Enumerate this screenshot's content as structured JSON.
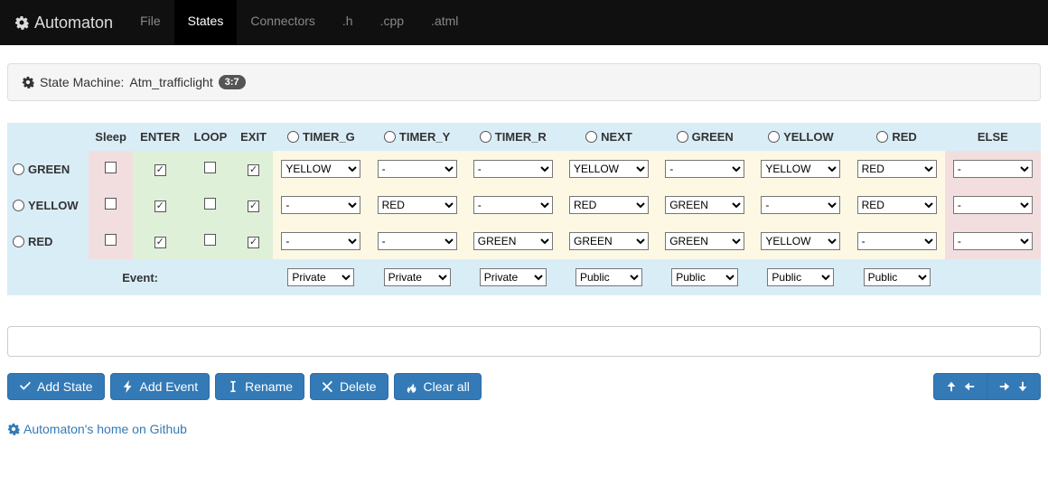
{
  "navbar": {
    "brand": "Automaton",
    "items": [
      {
        "label": "File",
        "active": false
      },
      {
        "label": "States",
        "active": true
      },
      {
        "label": "Connectors",
        "active": false
      },
      {
        "label": ".h",
        "active": false
      },
      {
        "label": ".cpp",
        "active": false
      },
      {
        "label": ".atml",
        "active": false
      }
    ]
  },
  "panel": {
    "prefix": "State Machine:",
    "name": "Atm_trafficlight",
    "badge": "3:7"
  },
  "columns": {
    "name_header": "",
    "sleep": "Sleep",
    "enter": "ENTER",
    "loop": "LOOP",
    "exit": "EXIT",
    "events": [
      "TIMER_G",
      "TIMER_Y",
      "TIMER_R",
      "NEXT",
      "GREEN",
      "YELLOW",
      "RED"
    ],
    "else": "ELSE"
  },
  "states": [
    {
      "name": "GREEN",
      "sleep": false,
      "enter": true,
      "loop": false,
      "exit": true,
      "transitions": [
        "YELLOW",
        "-",
        "-",
        "YELLOW",
        "-",
        "YELLOW",
        "RED"
      ],
      "else": "-"
    },
    {
      "name": "YELLOW",
      "sleep": false,
      "enter": true,
      "loop": false,
      "exit": true,
      "transitions": [
        "-",
        "RED",
        "-",
        "RED",
        "GREEN",
        "-",
        "RED"
      ],
      "else": "-"
    },
    {
      "name": "RED",
      "sleep": false,
      "enter": true,
      "loop": false,
      "exit": true,
      "transitions": [
        "-",
        "-",
        "GREEN",
        "GREEN",
        "GREEN",
        "YELLOW",
        "-"
      ],
      "else": "-"
    }
  ],
  "event_row_label": "Event:",
  "event_visibility": [
    "Private",
    "Private",
    "Private",
    "Public",
    "Public",
    "Public",
    "Public"
  ],
  "select_options": [
    "-",
    "GREEN",
    "YELLOW",
    "RED"
  ],
  "visibility_options": [
    "Private",
    "Public"
  ],
  "input": {
    "value": ""
  },
  "buttons": {
    "add_state": "Add State",
    "add_event": "Add Event",
    "rename": "Rename",
    "delete": "Delete",
    "clear_all": "Clear all"
  },
  "footer": {
    "label": "Automaton's home on Github"
  }
}
